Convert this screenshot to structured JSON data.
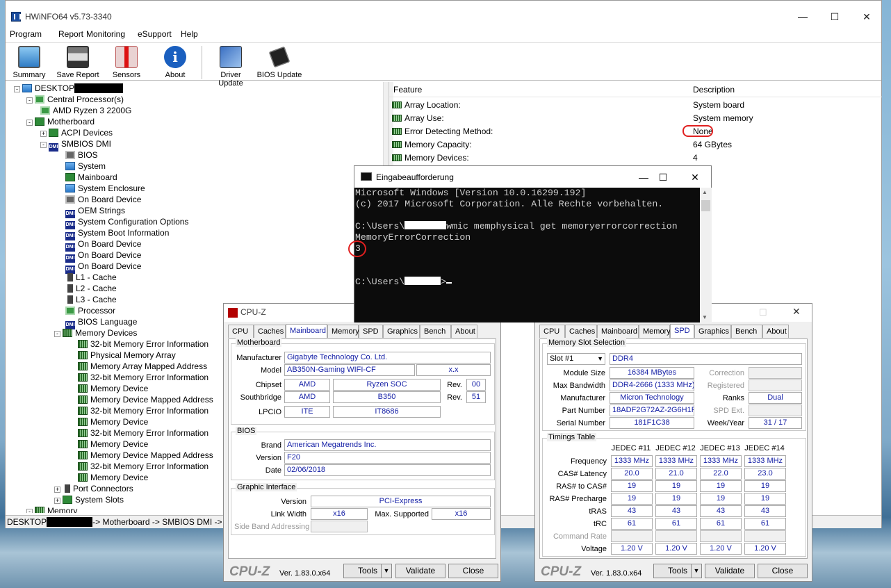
{
  "hwinfo": {
    "title": "HWiNFO64 v5.73-3340",
    "menu": [
      "Program",
      "Report",
      "Monitoring",
      "eSupport",
      "Help"
    ],
    "toolbar": [
      "Summary",
      "Save Report",
      "Sensors",
      "About",
      "Driver Update",
      "BIOS Update"
    ],
    "tree": [
      "DESKTOP",
      "Central Processor(s)",
      "AMD Ryzen 3 2200G",
      "Motherboard",
      "ACPI Devices",
      "SMBIOS DMI",
      "BIOS",
      "System",
      "Mainboard",
      "System Enclosure",
      "On Board Device",
      "OEM Strings",
      "System Configuration Options",
      "System Boot Information",
      "On Board Device",
      "On Board Device",
      "On Board Device",
      "L1 - Cache",
      "L2 - Cache",
      "L3 - Cache",
      "Processor",
      "BIOS Language",
      "Memory Devices",
      "32-bit Memory Error Information",
      "Physical Memory Array",
      "Memory Array Mapped Address",
      "32-bit Memory Error Information",
      "Memory Device",
      "Memory Device Mapped Address",
      "32-bit Memory Error Information",
      "Memory Device",
      "32-bit Memory Error Information",
      "Memory Device",
      "Memory Device Mapped Address",
      "32-bit Memory Error Information",
      "Memory Device",
      "Port Connectors",
      "System Slots",
      "Memory"
    ],
    "status": {
      "prefix": "DESKTOP",
      "path": "-> Motherboard -> SMBIOS DMI -> M"
    },
    "table": {
      "col_feature": "Feature",
      "col_description": "Description",
      "rows": [
        {
          "feature": "Array Location:",
          "description": "System board"
        },
        {
          "feature": "Array Use:",
          "description": "System memory"
        },
        {
          "feature": "Error Detecting Method:",
          "description": "None"
        },
        {
          "feature": "Memory Capacity:",
          "description": "64 GBytes"
        },
        {
          "feature": "Memory Devices:",
          "description": "4"
        }
      ]
    }
  },
  "cmd": {
    "title": "Eingabeaufforderung",
    "line1": "Microsoft Windows [Version 10.0.16299.192]",
    "line2": "(c) 2017 Microsoft Corporation. Alle Rechte vorbehalten.",
    "prompt_prefix": "C:\\Users\\",
    "command": "wmic memphysical get memoryerrorcorrection",
    "output_header": "MemoryErrorCorrection",
    "output_value": "3",
    "prompt_end": ">"
  },
  "cpuz1": {
    "title": "CPU-Z",
    "tabs": [
      "CPU",
      "Caches",
      "Mainboard",
      "Memory",
      "SPD",
      "Graphics",
      "Bench",
      "About"
    ],
    "active_tab": "Mainboard",
    "mb": {
      "group": "Motherboard",
      "manufacturer_l": "Manufacturer",
      "manufacturer": "Gigabyte Technology Co. Ltd.",
      "model_l": "Model",
      "model": "AB350N-Gaming WIFI-CF",
      "model_rev": "x.x",
      "chipset_l": "Chipset",
      "chipset_v": "AMD",
      "chipset_n": "Ryzen SOC",
      "rev_l": "Rev.",
      "chipset_rev": "00",
      "sb_l": "Southbridge",
      "sb_v": "AMD",
      "sb_n": "B350",
      "sb_rev": "51",
      "lpcio_l": "LPCIO",
      "lpcio_v": "ITE",
      "lpcio_n": "IT8686"
    },
    "bios": {
      "group": "BIOS",
      "brand_l": "Brand",
      "brand": "American Megatrends Inc.",
      "version_l": "Version",
      "version": "F20",
      "date_l": "Date",
      "date": "02/06/2018"
    },
    "gi": {
      "group": "Graphic Interface",
      "version_l": "Version",
      "version": "PCI-Express",
      "lw_l": "Link Width",
      "lw": "x16",
      "ms_l": "Max. Supported",
      "ms": "x16",
      "sba_l": "Side Band Addressing"
    },
    "footer": {
      "logo": "CPU-Z",
      "ver": "Ver. 1.83.0.x64",
      "tools": "Tools",
      "validate": "Validate",
      "close": "Close"
    }
  },
  "cpuz2": {
    "tabs": [
      "CPU",
      "Caches",
      "Mainboard",
      "Memory",
      "SPD",
      "Graphics",
      "Bench",
      "About"
    ],
    "active_tab": "SPD",
    "slot": {
      "group": "Memory Slot Selection",
      "slot": "Slot #1",
      "type": "DDR4",
      "module_size_l": "Module Size",
      "module_size": "16384 MBytes",
      "correction_l": "Correction",
      "max_bw_l": "Max Bandwidth",
      "max_bw": "DDR4-2666 (1333 MHz)",
      "registered_l": "Registered",
      "mfr_l": "Manufacturer",
      "mfr": "Micron Technology",
      "ranks_l": "Ranks",
      "ranks": "Dual",
      "pn_l": "Part Number",
      "pn": "18ADF2G72AZ-2G6H1R",
      "spd_ext_l": "SPD Ext.",
      "sn_l": "Serial Number",
      "sn": "181F1C38",
      "ww_l": "Week/Year",
      "ww": "31 / 17"
    },
    "timings": {
      "group": "Timings Table",
      "cols": [
        "JEDEC #11",
        "JEDEC #12",
        "JEDEC #13",
        "JEDEC #14"
      ],
      "rows": [
        {
          "label": "Frequency",
          "v": [
            "1333 MHz",
            "1333 MHz",
            "1333 MHz",
            "1333 MHz"
          ]
        },
        {
          "label": "CAS# Latency",
          "v": [
            "20.0",
            "21.0",
            "22.0",
            "23.0"
          ]
        },
        {
          "label": "RAS# to CAS#",
          "v": [
            "19",
            "19",
            "19",
            "19"
          ]
        },
        {
          "label": "RAS# Precharge",
          "v": [
            "19",
            "19",
            "19",
            "19"
          ]
        },
        {
          "label": "tRAS",
          "v": [
            "43",
            "43",
            "43",
            "43"
          ]
        },
        {
          "label": "tRC",
          "v": [
            "61",
            "61",
            "61",
            "61"
          ]
        },
        {
          "label": "Command Rate",
          "v": [
            "",
            "",
            "",
            ""
          ]
        },
        {
          "label": "Voltage",
          "v": [
            "1.20 V",
            "1.20 V",
            "1.20 V",
            "1.20 V"
          ]
        }
      ]
    },
    "footer": {
      "logo": "CPU-Z",
      "ver": "Ver. 1.83.0.x64",
      "tools": "Tools",
      "validate": "Validate",
      "close": "Close"
    }
  }
}
